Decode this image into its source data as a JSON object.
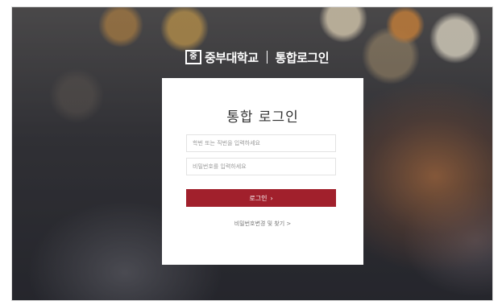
{
  "logo": {
    "mark": "중",
    "university": "중부대학교",
    "title": "통합로그인"
  },
  "login_card": {
    "title": "통합 로그인",
    "id_placeholder": "학번 또는 직번을 입력하세요",
    "password_placeholder": "비밀번호를 입력하세요",
    "login_button": "로그인",
    "login_button_icon": "chevron-right-icon",
    "find_password_link": "비밀번호변경 및 찾기 >"
  },
  "colors": {
    "accent": "#a1202c"
  }
}
